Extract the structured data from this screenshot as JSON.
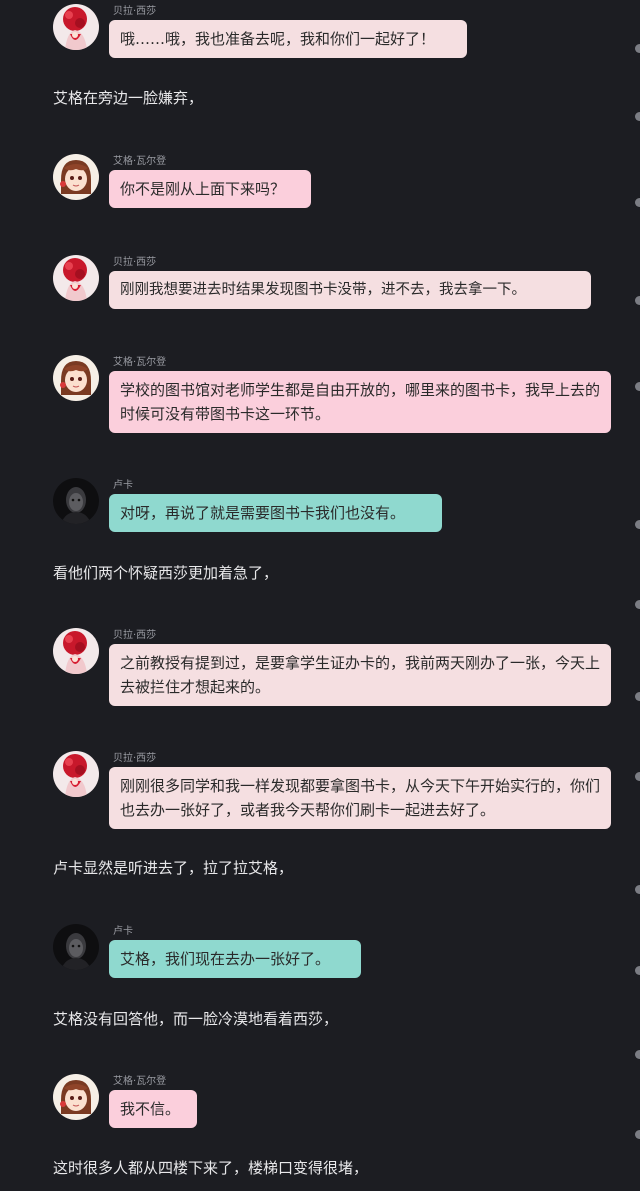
{
  "speakers": {
    "bella": "贝拉·西莎",
    "aige": "艾格·瓦尔登",
    "luka": "卢卡"
  },
  "icons": {
    "bella_avatar": "rose-girl-avatar-icon",
    "aige_avatar": "anime-girl-avatar-icon",
    "luka_avatar": "dark-portrait-avatar-icon"
  },
  "colors": {
    "background": "#1c1d22",
    "bella_bubble": "#f5dfe1",
    "aige_bubble": "#fbcfdc",
    "luka_bubble": "#8fd9cf",
    "narration_text": "#e8e8ea"
  },
  "conversation": {
    "m1": "哦……哦，我也准备去呢，我和你们一起好了！",
    "n1": "艾格在旁边一脸嫌弃，",
    "m2": "你不是刚从上面下来吗？",
    "m3": "刚刚我想要进去时结果发现图书卡没带，进不去，我去拿一下。",
    "m4": "学校的图书馆对老师学生都是自由开放的，哪里来的图书卡，我早上去的时候可没有带图书卡这一环节。",
    "m5": "对呀，再说了就是需要图书卡我们也没有。",
    "n2": "看他们两个怀疑西莎更加着急了，",
    "m6": "之前教授有提到过，是要拿学生证办卡的，我前两天刚办了一张，今天上去被拦住才想起来的。",
    "m7": "刚刚很多同学和我一样发现都要拿图书卡，从今天下午开始实行的，你们也去办一张好了，或者我今天帮你们刷卡一起进去好了。",
    "n3": "卢卡显然是听进去了，拉了拉艾格，",
    "m8": "艾格，我们现在去办一张好了。",
    "n4": "艾格没有回答他，而一脸冷漠地看着西莎，",
    "m9": "我不信。",
    "n5": "这时很多人都从四楼下来了，楼梯口变得很堵，"
  }
}
